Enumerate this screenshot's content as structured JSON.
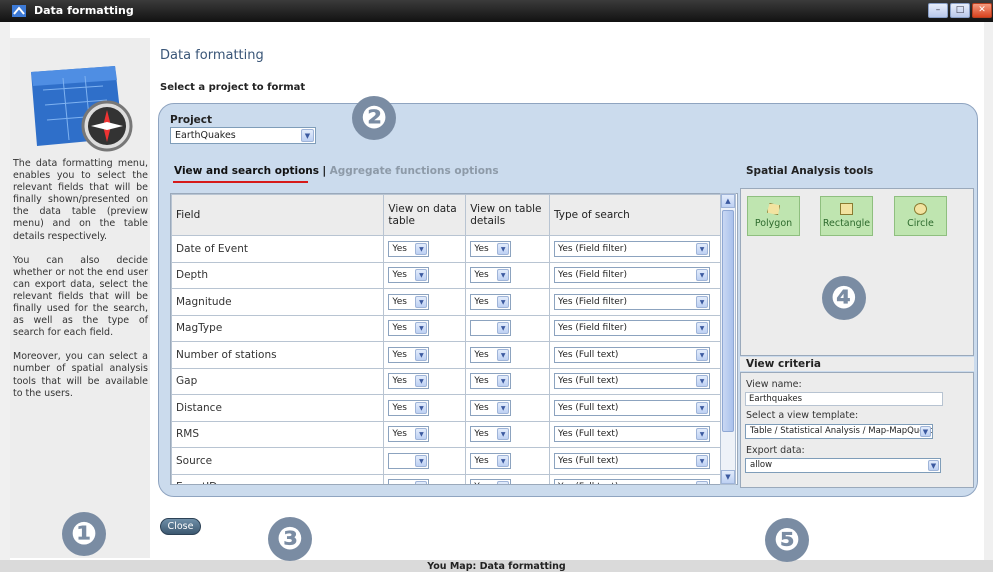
{
  "window": {
    "title": "Data formatting",
    "minimize": "–",
    "maximize": "□",
    "close": "✕"
  },
  "sidebar": {
    "help_paragraphs": [
      "The data formatting menu, enables you to select the relevant fields that will be finally shown/presented on the data table (preview menu) and on the table details respectively.",
      "You can also decide whether or not the end user can export data, select the relevant fields that will be finally used for the search, as well as the type of search for each field.",
      "Moreover, you can select a number of spatial analysis tools that will be available to the users."
    ]
  },
  "badges": [
    "❶",
    "❷",
    "❸",
    "❹",
    "❺"
  ],
  "main": {
    "page_title": "Data formatting",
    "section_title": "Select a project to format",
    "project_label": "Project",
    "project_value": "EarthQuakes",
    "tabs": {
      "active": "View and search options",
      "separator": "|",
      "inactive": "Aggregate functions options"
    },
    "table": {
      "headers": [
        "Field",
        "View on data table",
        "View on table details",
        "Type of search"
      ],
      "rows": [
        {
          "field": "Date of Event",
          "data": "Yes",
          "details": "Yes",
          "search": "Yes (Field filter)"
        },
        {
          "field": "Depth",
          "data": "Yes",
          "details": "Yes",
          "search": "Yes (Field filter)"
        },
        {
          "field": "Magnitude",
          "data": "Yes",
          "details": "Yes",
          "search": "Yes (Field filter)"
        },
        {
          "field": "MagType",
          "data": "Yes",
          "details": "",
          "search": "Yes (Field filter)"
        },
        {
          "field": "Number of stations",
          "data": "Yes",
          "details": "Yes",
          "search": "Yes (Full text)"
        },
        {
          "field": "Gap",
          "data": "Yes",
          "details": "Yes",
          "search": "Yes (Full text)"
        },
        {
          "field": "Distance",
          "data": "Yes",
          "details": "Yes",
          "search": "Yes (Full text)"
        },
        {
          "field": "RMS",
          "data": "Yes",
          "details": "Yes",
          "search": "Yes (Full text)"
        },
        {
          "field": "Source",
          "data": "",
          "details": "Yes",
          "search": "Yes (Full text)"
        },
        {
          "field": "EventID",
          "data": "",
          "details": "Yes",
          "search": "Yes (Full text)"
        }
      ]
    }
  },
  "spatial": {
    "title": "Spatial Analysis tools",
    "tools": [
      "Polygon",
      "Rectangle",
      "Circle"
    ]
  },
  "criteria": {
    "title": "View criteria",
    "view_name_label": "View name:",
    "view_name_value": "Earthquakes",
    "template_label": "Select a view template:",
    "template_value": "Table / Statistical Analysis / Map-MapQuest",
    "export_label": "Export data:",
    "export_value": "allow"
  },
  "footer": {
    "close_label": "Close",
    "status": "You Map: Data formatting"
  }
}
